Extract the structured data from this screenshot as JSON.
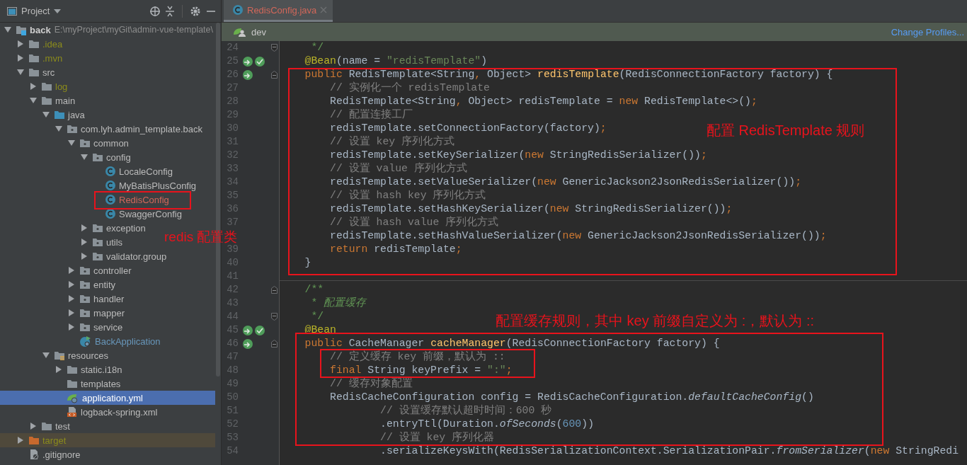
{
  "project_panel": {
    "title": "Project",
    "tree": {
      "label": "back",
      "path": "E:\\myProject\\myGit\\admin-vue-template\\",
      "kind": "module",
      "expanded": true,
      "selected": false,
      "children": [
        {
          "label": ".idea",
          "kind": "folder",
          "expanded": false,
          "selected": false,
          "ignored": true
        },
        {
          "label": ".mvn",
          "kind": "folder",
          "expanded": false,
          "selected": false,
          "ignored": true
        },
        {
          "label": "src",
          "kind": "folder",
          "expanded": true,
          "selected": false,
          "children": [
            {
              "label": "log",
              "kind": "folder",
              "expanded": false,
              "selected": false,
              "ignored": true
            },
            {
              "label": "main",
              "kind": "folder",
              "expanded": true,
              "selected": false,
              "children": [
                {
                  "label": "java",
                  "kind": "source-root",
                  "expanded": true,
                  "selected": false,
                  "children": [
                    {
                      "label": "com.lyh.admin_template.back",
                      "kind": "package",
                      "expanded": true,
                      "selected": false,
                      "children": [
                        {
                          "label": "common",
                          "kind": "package",
                          "expanded": true,
                          "selected": false,
                          "children": [
                            {
                              "label": "config",
                              "kind": "package",
                              "expanded": true,
                              "selected": false,
                              "children": [
                                {
                                  "label": "LocaleConfig",
                                  "kind": "class",
                                  "selected": false
                                },
                                {
                                  "label": "MyBatisPlusConfig",
                                  "kind": "class",
                                  "selected": false
                                },
                                {
                                  "label": "RedisConfig",
                                  "kind": "class",
                                  "selected": false,
                                  "unversioned": true
                                },
                                {
                                  "label": "SwaggerConfig",
                                  "kind": "class",
                                  "selected": false
                                }
                              ]
                            },
                            {
                              "label": "exception",
                              "kind": "package",
                              "expanded": false,
                              "selected": false
                            },
                            {
                              "label": "utils",
                              "kind": "package",
                              "expanded": false,
                              "selected": false
                            },
                            {
                              "label": "validator.group",
                              "kind": "package",
                              "expanded": false,
                              "selected": false
                            }
                          ]
                        },
                        {
                          "label": "controller",
                          "kind": "package",
                          "expanded": false,
                          "selected": false
                        },
                        {
                          "label": "entity",
                          "kind": "package",
                          "expanded": false,
                          "selected": false
                        },
                        {
                          "label": "handler",
                          "kind": "package",
                          "expanded": false,
                          "selected": false
                        },
                        {
                          "label": "mapper",
                          "kind": "package",
                          "expanded": false,
                          "selected": false
                        },
                        {
                          "label": "service",
                          "kind": "package",
                          "expanded": false,
                          "selected": false
                        },
                        {
                          "label": "BackApplication",
                          "kind": "boot-class",
                          "selected": false,
                          "modified": true
                        }
                      ]
                    }
                  ]
                },
                {
                  "label": "resources",
                  "kind": "resources-root",
                  "expanded": true,
                  "selected": false,
                  "children": [
                    {
                      "label": "static.i18n",
                      "kind": "folder",
                      "expanded": false,
                      "selected": false
                    },
                    {
                      "label": "templates",
                      "kind": "folder",
                      "selected": false
                    },
                    {
                      "label": "application.yml",
                      "kind": "yml",
                      "selected": true
                    },
                    {
                      "label": "logback-spring.xml",
                      "kind": "xml",
                      "selected": false
                    }
                  ]
                }
              ]
            },
            {
              "label": "test",
              "kind": "folder",
              "expanded": false,
              "selected": false
            }
          ]
        },
        {
          "label": "target",
          "kind": "folder",
          "expanded": false,
          "selected": false,
          "excluded": true
        },
        {
          "label": ".gitignore",
          "kind": "ignore-file",
          "selected": false
        }
      ]
    }
  },
  "editor": {
    "tabs": [
      {
        "label": "RedisConfig.java",
        "selected": true,
        "unversioned": true
      }
    ],
    "profile_bar": {
      "profile": "dev",
      "link": "Change Profiles..."
    },
    "lines": [
      {
        "number": "24",
        "fold": {
          "kind": "end"
        },
        "tokens": [
          {
            "text": "     */",
            "kind": "doc"
          }
        ]
      },
      {
        "number": "25",
        "gutter": [
          {
            "kind": "arrow"
          },
          {
            "kind": "check"
          }
        ],
        "tokens": [
          {
            "text": "    @Bean",
            "kind": "annotation"
          },
          {
            "text": "(name = ",
            "kind": "plain"
          },
          {
            "text": "\"redisTemplate\"",
            "kind": "string"
          },
          {
            "text": ")",
            "kind": "plain"
          }
        ]
      },
      {
        "number": "26",
        "gutter": [
          {
            "kind": "arrow"
          }
        ],
        "fold": {
          "kind": "start"
        },
        "tokens": [
          {
            "text": "    public",
            "kind": "keyword"
          },
          {
            "text": " RedisTemplate<String",
            "kind": "plain"
          },
          {
            "text": ",",
            "kind": "punct"
          },
          {
            "text": " Object> ",
            "kind": "plain"
          },
          {
            "text": "redisTemplate",
            "kind": "method"
          },
          {
            "text": "(RedisConnectionFactory factory) {",
            "kind": "plain"
          }
        ]
      },
      {
        "number": "27",
        "tokens": [
          {
            "text": "        // 实例化一个 redisTemplate",
            "kind": "comment"
          }
        ]
      },
      {
        "number": "28",
        "tokens": [
          {
            "text": "        RedisTemplate<String",
            "kind": "plain"
          },
          {
            "text": ",",
            "kind": "punct"
          },
          {
            "text": " Object> redisTemplate = ",
            "kind": "plain"
          },
          {
            "text": "new",
            "kind": "keyword"
          },
          {
            "text": " RedisTemplate<>()",
            "kind": "plain"
          },
          {
            "text": ";",
            "kind": "punct"
          }
        ]
      },
      {
        "number": "29",
        "tokens": [
          {
            "text": "        // 配置连接工厂",
            "kind": "comment"
          }
        ]
      },
      {
        "number": "30",
        "tokens": [
          {
            "text": "        redisTemplate.setConnectionFactory(factory)",
            "kind": "plain"
          },
          {
            "text": ";",
            "kind": "punct"
          }
        ]
      },
      {
        "number": "31",
        "tokens": [
          {
            "text": "        // 设置 key 序列化方式",
            "kind": "comment"
          }
        ]
      },
      {
        "number": "32",
        "tokens": [
          {
            "text": "        redisTemplate.setKeySerializer(",
            "kind": "plain"
          },
          {
            "text": "new",
            "kind": "keyword"
          },
          {
            "text": " StringRedisSerializer())",
            "kind": "plain"
          },
          {
            "text": ";",
            "kind": "punct"
          }
        ]
      },
      {
        "number": "33",
        "tokens": [
          {
            "text": "        // 设置 value 序列化方式",
            "kind": "comment"
          }
        ]
      },
      {
        "number": "34",
        "tokens": [
          {
            "text": "        redisTemplate.setValueSerializer(",
            "kind": "plain"
          },
          {
            "text": "new",
            "kind": "keyword"
          },
          {
            "text": " GenericJackson2JsonRedisSerializer())",
            "kind": "plain"
          },
          {
            "text": ";",
            "kind": "punct"
          }
        ]
      },
      {
        "number": "35",
        "tokens": [
          {
            "text": "        // 设置 hash key 序列化方式",
            "kind": "comment"
          }
        ]
      },
      {
        "number": "36",
        "tokens": [
          {
            "text": "        redisTemplate.setHashKeySerializer(",
            "kind": "plain"
          },
          {
            "text": "new",
            "kind": "keyword"
          },
          {
            "text": " StringRedisSerializer())",
            "kind": "plain"
          },
          {
            "text": ";",
            "kind": "punct"
          }
        ]
      },
      {
        "number": "37",
        "tokens": [
          {
            "text": "        // 设置 hash value 序列化方式",
            "kind": "comment"
          }
        ]
      },
      {
        "tokens": [
          {
            "text": "        redisTemplate.setHashValueSerializer(",
            "kind": "plain"
          },
          {
            "text": "new",
            "kind": "keyword"
          },
          {
            "text": " GenericJackson2JsonRedisSerializer())",
            "kind": "plain"
          },
          {
            "text": ";",
            "kind": "punct"
          }
        ]
      },
      {
        "number": "39",
        "tokens": [
          {
            "text": "        return",
            "kind": "keyword"
          },
          {
            "text": " redisTemplate",
            "kind": "plain"
          },
          {
            "text": ";",
            "kind": "punct"
          }
        ]
      },
      {
        "number": "40",
        "tokens": [
          {
            "text": "    }",
            "kind": "plain"
          }
        ]
      },
      {
        "number": "41",
        "separator": true
      },
      {
        "number": "42",
        "fold": {
          "kind": "start"
        },
        "tokens": [
          {
            "text": "    /**",
            "kind": "doc"
          }
        ]
      },
      {
        "number": "43",
        "tokens": [
          {
            "text": "     * ",
            "kind": "doc"
          },
          {
            "text": "配置缓存",
            "kind": "doc-italic"
          }
        ]
      },
      {
        "number": "44",
        "fold": {
          "kind": "end"
        },
        "tokens": [
          {
            "text": "     */",
            "kind": "doc"
          }
        ]
      },
      {
        "number": "45",
        "gutter": [
          {
            "kind": "arrow"
          },
          {
            "kind": "check"
          }
        ],
        "tokens": [
          {
            "text": "    @Bean",
            "kind": "annotation"
          }
        ]
      },
      {
        "number": "46",
        "gutter": [
          {
            "kind": "arrow"
          }
        ],
        "fold": {
          "kind": "start"
        },
        "tokens": [
          {
            "text": "    public",
            "kind": "keyword"
          },
          {
            "text": " CacheManager ",
            "kind": "plain"
          },
          {
            "text": "cacheManager",
            "kind": "method"
          },
          {
            "text": "(RedisConnectionFactory factory) {",
            "kind": "plain"
          }
        ]
      },
      {
        "number": "47",
        "tokens": [
          {
            "text": "        // 定义缓存 key 前缀，默认为 ::",
            "kind": "comment"
          }
        ]
      },
      {
        "number": "48",
        "tokens": [
          {
            "text": "        final",
            "kind": "keyword"
          },
          {
            "text": " String keyPrefix = ",
            "kind": "plain"
          },
          {
            "text": "\":\"",
            "kind": "string"
          },
          {
            "text": ";",
            "kind": "punct"
          }
        ]
      },
      {
        "number": "49",
        "tokens": [
          {
            "text": "        // 缓存对象配置",
            "kind": "comment"
          }
        ]
      },
      {
        "number": "50",
        "tokens": [
          {
            "text": "        RedisCacheConfiguration config = RedisCacheConfiguration.",
            "kind": "plain"
          },
          {
            "text": "defaultCacheConfig",
            "kind": "static"
          },
          {
            "text": "()",
            "kind": "plain"
          }
        ]
      },
      {
        "number": "51",
        "tokens": [
          {
            "text": "                // 设置缓存默认超时时间：600 秒",
            "kind": "comment"
          }
        ]
      },
      {
        "number": "52",
        "tokens": [
          {
            "text": "                .entryTtl(Duration.",
            "kind": "plain"
          },
          {
            "text": "ofSeconds",
            "kind": "static"
          },
          {
            "text": "(",
            "kind": "plain"
          },
          {
            "text": "600",
            "kind": "number"
          },
          {
            "text": "))",
            "kind": "plain"
          }
        ]
      },
      {
        "number": "53",
        "tokens": [
          {
            "text": "                // 设置 key 序列化器",
            "kind": "comment"
          }
        ]
      },
      {
        "number": "54",
        "tokens": [
          {
            "text": "                .serializeKeysWith(RedisSerializationContext.SerializationPair.",
            "kind": "plain"
          },
          {
            "text": "fromSerializer",
            "kind": "static"
          },
          {
            "text": "(",
            "kind": "plain"
          },
          {
            "text": "new",
            "kind": "keyword"
          },
          {
            "text": " StringRedi",
            "kind": "plain"
          }
        ]
      }
    ]
  },
  "annotations": [
    {
      "text": "redis 配置类"
    },
    {
      "text": "配置 RedisTemplate 规则"
    },
    {
      "text": "配置缓存规则，其中 key 前缀自定义为 :，默认为 ::"
    }
  ]
}
